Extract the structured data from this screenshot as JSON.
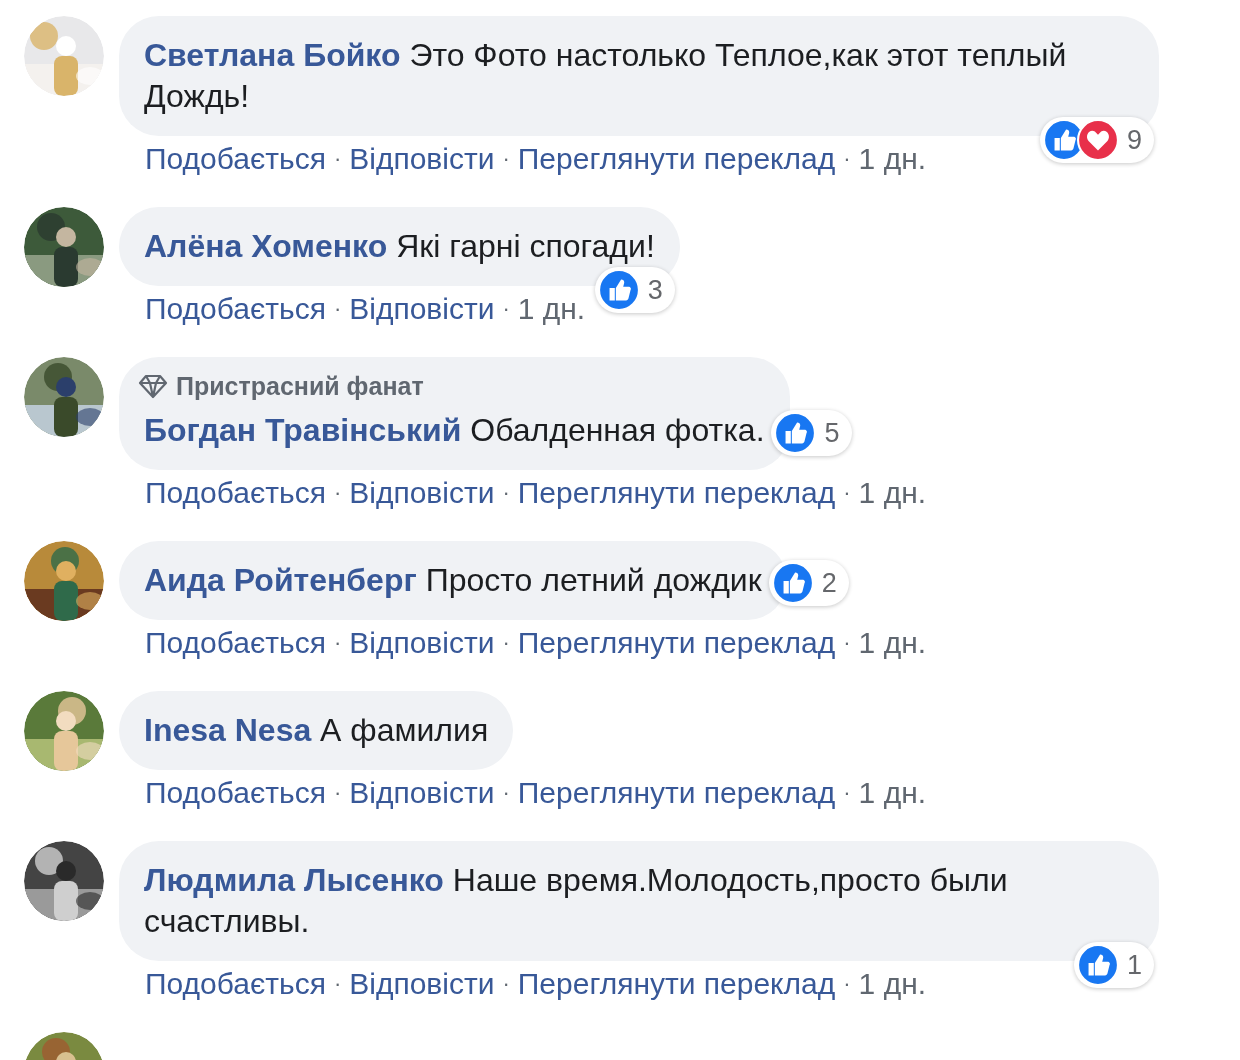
{
  "separator": "·",
  "comments": [
    {
      "name": "Светлана Бойко",
      "text": "Это Фото настолько Теплое,как этот теплый Дождь!",
      "reactions": [
        {
          "kind": "like"
        },
        {
          "kind": "love"
        }
      ],
      "reaction_count": "9",
      "actions": [
        "Подобається",
        "Відповісти",
        "Переглянути переклад"
      ],
      "time": "1 дн."
    },
    {
      "name": "Алёна Хоменко",
      "text": "Які гарні спогади!",
      "reactions": [
        {
          "kind": "like"
        }
      ],
      "reaction_count": "3",
      "actions": [
        "Подобається",
        "Відповісти"
      ],
      "time": "1 дн."
    },
    {
      "badge": "Пристрасний фанат",
      "name": "Богдан Травінський",
      "text": "Обалденная фотка.",
      "reactions": [
        {
          "kind": "like"
        }
      ],
      "reaction_count": "5",
      "reactions_beside": true,
      "actions": [
        "Подобається",
        "Відповісти",
        "Переглянути переклад"
      ],
      "time": "1 дн."
    },
    {
      "name": "Аида Ройтенберг",
      "text": "Просто летний дождик",
      "reactions": [
        {
          "kind": "like"
        }
      ],
      "reaction_count": "2",
      "reactions_beside": true,
      "actions": [
        "Подобається",
        "Відповісти",
        "Переглянути переклад"
      ],
      "time": "1 дн."
    },
    {
      "name": "Inesa Nesa",
      "text": "А фамилия",
      "actions": [
        "Подобається",
        "Відповісти",
        "Переглянути переклад"
      ],
      "time": "1 дн."
    },
    {
      "name": "Людмила Лысенко",
      "text": "Наше время.Молодость,просто были счастливы.",
      "reactions": [
        {
          "kind": "like"
        }
      ],
      "reaction_count": "1",
      "actions": [
        "Подобається",
        "Відповісти",
        "Переглянути переклад"
      ],
      "time": "1 дн."
    }
  ]
}
